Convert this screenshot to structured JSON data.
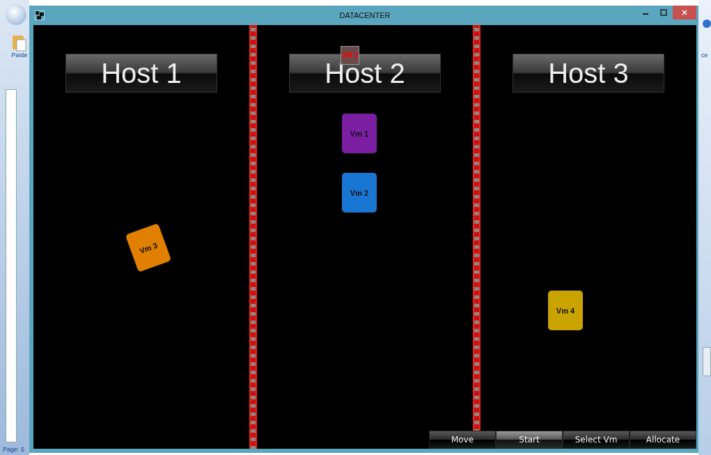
{
  "background_app": {
    "paste_label": "Paste",
    "status": "Page: 5",
    "ribbon_text": "ce"
  },
  "window": {
    "title": "DATACENTER"
  },
  "hosts": [
    {
      "title": "Host 1",
      "vms": [
        {
          "label": "Vm 3",
          "color": "#e07f00"
        }
      ]
    },
    {
      "title": "Host 2",
      "vms": [
        {
          "label": "Vm 1",
          "color": "#7b1fa2"
        },
        {
          "label": "Vm 2",
          "color": "#1976d2"
        }
      ]
    },
    {
      "title": "Host 3",
      "vms": [
        {
          "label": "Vm 4",
          "color": "#c9a400"
        }
      ]
    }
  ],
  "drag_badge": "VM 3",
  "buttons": [
    {
      "label": "Move",
      "selected": false
    },
    {
      "label": "Start",
      "selected": true
    },
    {
      "label": "Select Vm",
      "selected": false
    },
    {
      "label": "Allocate",
      "selected": false
    }
  ]
}
